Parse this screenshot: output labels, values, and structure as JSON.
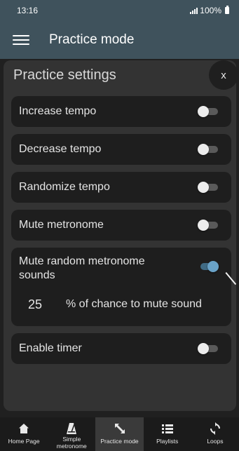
{
  "status_bar": {
    "time": "13:16",
    "battery": "100%"
  },
  "app_bar": {
    "title": "Practice mode"
  },
  "dialog": {
    "title": "Practice settings",
    "close_label": "x",
    "settings": [
      {
        "label": "Increase tempo",
        "enabled": false
      },
      {
        "label": "Decrease tempo",
        "enabled": false
      },
      {
        "label": "Randomize tempo",
        "enabled": false
      },
      {
        "label": "Mute metronome",
        "enabled": false
      },
      {
        "label": "Mute random metronome sounds",
        "enabled": true
      },
      {
        "label": "Enable timer",
        "enabled": false
      }
    ],
    "mute_chance": {
      "value": "25",
      "label": "% of chance to mute sound"
    }
  },
  "bottom_nav": [
    {
      "label": "Home Page",
      "icon": "home-icon"
    },
    {
      "label": "Simple metronome",
      "icon": "metronome-icon"
    },
    {
      "label": "Practice mode",
      "icon": "practice-arrows-icon",
      "active": true
    },
    {
      "label": "Playlists",
      "icon": "list-icon"
    },
    {
      "label": "Loops",
      "icon": "loop-icon"
    }
  ],
  "colors": {
    "app_bar": "#3f525c",
    "toggle_on": "#6aa3c8",
    "card": "#1e1e1e",
    "dialog": "#333333"
  }
}
